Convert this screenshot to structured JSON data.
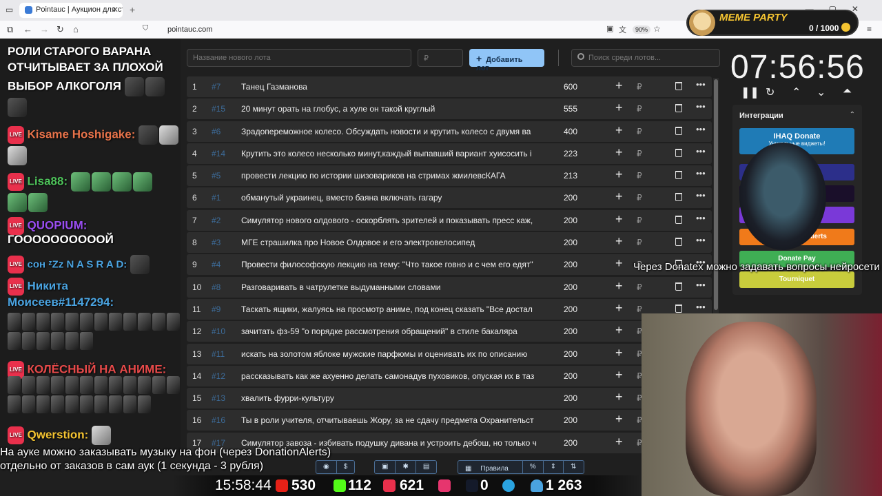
{
  "browser": {
    "tab_title": "Pointauc | Аукцион для стрим",
    "url": "pointauc.com",
    "zoom": "90%"
  },
  "meme_party": {
    "title": "MEME PARTY",
    "progress": "0 / 1000"
  },
  "chat": {
    "line1": "РОЛИ СТАРОГО ВАРАНА",
    "line2": "ОТЧИТЫВАЕТ ЗА ПЛОХОЙ",
    "line3": "ВЫБОР АЛКОГОЛЯ",
    "msgs": [
      {
        "user": "Kisame Hoshigake:",
        "color": "#e8734a"
      },
      {
        "user": "Lisa88:",
        "color": "#4ec35a"
      },
      {
        "user": "QUOPIUM:",
        "color": "#9a4df2",
        "text": "ГООООООООООЙ"
      },
      {
        "user": "сон ᶻZz N A S R A D:",
        "color": "#4aa3e0"
      },
      {
        "user": "Никита",
        "user2": "Моисеев#1147294:",
        "color": "#4aa3e0"
      },
      {
        "user": "КОЛЁСНЫЙ НА АНИМЕ:",
        "color": "#e84a4a"
      },
      {
        "user": "Qwerstion:",
        "color": "#f5c431"
      }
    ],
    "live_badge": "LIVE"
  },
  "form": {
    "lot_placeholder": "Название нового лота",
    "price_placeholder": "₽",
    "add_label": "Добавить лот",
    "search_placeholder": "Поиск среди лотов..."
  },
  "lots": [
    {
      "n": "1",
      "id": "#7",
      "name": "Танец Газманова",
      "amount": "600"
    },
    {
      "n": "2",
      "id": "#15",
      "name": "20 минут орать на глобус, а хуле он такой круглый",
      "amount": "555"
    },
    {
      "n": "3",
      "id": "#6",
      "name": "Зрадопереможное колесо. Обсуждать новости и крутить колесо с двумя ва",
      "amount": "400"
    },
    {
      "n": "4",
      "id": "#14",
      "name": "Крутить это колесо несколько минут,каждый выпавший вариант хуисосить і",
      "amount": "223"
    },
    {
      "n": "5",
      "id": "#5",
      "name": "провести лекцию по истории шизовариков на стримах жмилевсКАГА",
      "amount": "213"
    },
    {
      "n": "6",
      "id": "#1",
      "name": "обманутый украинец, вместо баяна включать гагару",
      "amount": "200"
    },
    {
      "n": "7",
      "id": "#2",
      "name": "Симулятор нового олдового - оскорблять зрителей и показывать пресс каж,",
      "amount": "200"
    },
    {
      "n": "8",
      "id": "#3",
      "name": " МГЕ страшилка про Новое Олдовое и его электровелосипед",
      "amount": "200"
    },
    {
      "n": "9",
      "id": "#4",
      "name": "Провести философскую лекцию на тему: \"Что такое говно и с чем его едят\"",
      "amount": "200"
    },
    {
      "n": "10",
      "id": "#8",
      "name": "Разговаривать в чатрулетке выдуманными словами",
      "amount": "200"
    },
    {
      "n": "11",
      "id": "#9",
      "name": "Таскать ящики, жалуясь на просмотр аниме, под конец сказать \"Все достал",
      "amount": "200"
    },
    {
      "n": "12",
      "id": "#10",
      "name": "зачитать фз-59 \"о порядке рассмотрения обращений\" в стиле бакаляра",
      "amount": "200"
    },
    {
      "n": "13",
      "id": "#11",
      "name": " искать на золотом яблоке мужские парфюмы и оценивать их по описанию",
      "amount": "200"
    },
    {
      "n": "14",
      "id": "#12",
      "name": "рассказывать как же ахуенно делать самонадув пуховиков, опуская их в таз",
      "amount": "200"
    },
    {
      "n": "15",
      "id": "#13",
      "name": "хвалить фурри-культуру",
      "amount": "200"
    },
    {
      "n": "16",
      "id": "#16",
      "name": "Ты в роли учителя, отчитываешь Жору, за не сдачу предмета Охранительст",
      "amount": "200"
    },
    {
      "n": "17",
      "id": "#17",
      "name": "Симулятор завоза - избивать подушку дивана и устроить дебош, но только ч",
      "amount": "200"
    }
  ],
  "currency": "₽",
  "timer": "07:56:56",
  "integrations": {
    "title": "Интеграции",
    "ihaq": "IHAQ Donate",
    "ihaq_sub": "Уникальные виджеты!",
    "da": "Alerts",
    "donatepay": "Donate Pay",
    "tourniquet": "Tourniquet"
  },
  "overlay_text": "Через Donatex можно задавать вопросы нейросети",
  "announce": {
    "line1": "На ауке можно заказывать музыку на фон (через DonationAlerts)",
    "line2": "отдельно от заказов в сам аук (1 секунда - 3 рубля)"
  },
  "toolbar": {
    "rules": "Правила",
    "dollar": "$",
    "percent": "%"
  },
  "stats": {
    "time": "15:58:44",
    "youtube": "530",
    "kick": "112",
    "live": "621",
    "rutube": "0",
    "viewers": "1 263"
  }
}
